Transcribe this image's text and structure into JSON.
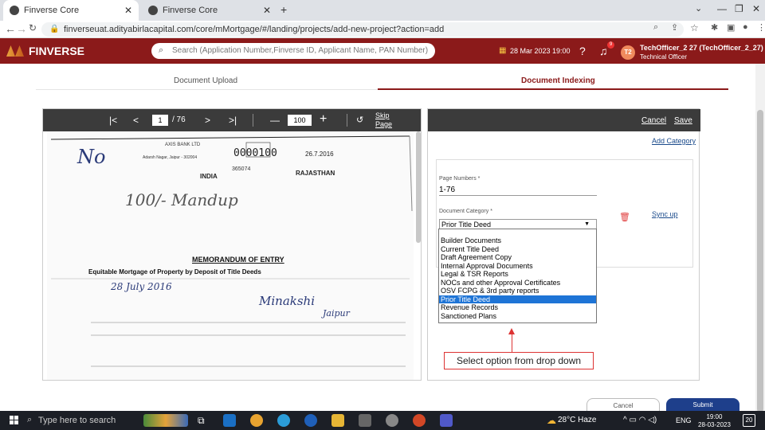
{
  "browser": {
    "tabs": [
      {
        "title": "Finverse Core"
      },
      {
        "title": "Finverse Core"
      }
    ],
    "url": "finverseuat.adityabirlacapital.com/core/mMortgage/#/landing/projects/add-new-project?action=add"
  },
  "header": {
    "brand": "FINVERSE",
    "search_placeholder": "Search (Application Number,Finverse ID, Applicant Name, PAN Number)",
    "datetime": "28 Mar 2023 19:00",
    "notification_count": "9",
    "avatar_initials": "T2",
    "user_name": "TechOfficer_2 27 (TechOfficer_2_27)",
    "user_role": "Technical Officer"
  },
  "tabs": {
    "upload": "Document Upload",
    "indexing": "Document Indexing"
  },
  "viewer": {
    "first": "|<",
    "prev": "<",
    "page": "1",
    "total": "/ 76",
    "next": ">",
    "last": ">|",
    "zoom_out": "—",
    "zoom": "100",
    "zoom_in": "+",
    "skip": "Skip",
    "page_word": "Page",
    "doc_heading": "MEMORANDUM OF ENTRY",
    "doc_subheading": "Equitable Mortgage of Property by Deposit of Title Deeds",
    "stamp_bank": "AXIS BANK LTD",
    "stamp_addr": "Adarsh Nagar, Jaipur - 302004",
    "stamp_amount": "0000100",
    "stamp_date": "26.7.2016",
    "stamp_no": "365074",
    "stamp_state": "RAJASTHAN",
    "stamp_country": "INDIA",
    "hw1": "No",
    "hw2": "100/- Mandup",
    "hw_date": "28 July 2016",
    "hw_name": "Minakshi",
    "hw_place": "Jaipur"
  },
  "panel": {
    "cancel": "Cancel",
    "save": "Save",
    "add_category": "Add Category",
    "page_numbers_label": "Page Numbers *",
    "page_numbers_value": "1-76",
    "doc_category_label": "Document Category *",
    "doc_category_value": "Prior Title Deed",
    "sync_up": "Sync up",
    "options": [
      "Builder Documents",
      "Current Title Deed",
      "Draft Agreement Copy",
      "Internal Approval Documents",
      "Legal & TSR Reports",
      "NOCs and other Approval Certificates",
      "OSV FCPG & 3rd party reports",
      "Prior Title Deed",
      "Revenue Records",
      "Sanctioned Plans"
    ],
    "selected_index": 7
  },
  "callout": "Select option from drop down",
  "footer": {
    "cancel": "Cancel",
    "submit": "Submit"
  },
  "taskbar": {
    "search": "Type here to search",
    "weather": "28°C  Haze",
    "lang": "ENG",
    "time": "19:00",
    "date": "28-03-2023",
    "notif": "20"
  }
}
